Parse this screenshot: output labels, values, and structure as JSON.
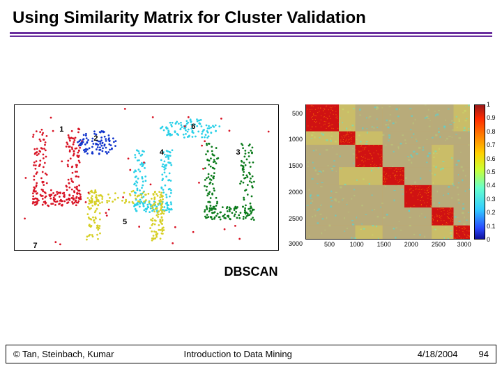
{
  "title": "Using Similarity Matrix for Cluster Validation",
  "caption": "DBSCAN",
  "footer": {
    "authors": "© Tan, Steinbach, Kumar",
    "mid": "Introduction to Data Mining",
    "date": "4/18/2004",
    "page": "94"
  },
  "chart_data": [
    {
      "type": "scatter",
      "title": "",
      "clusters": [
        {
          "id": "1",
          "color": "#d81324",
          "label_pos": [
            0.17,
            0.14
          ],
          "shape": "upper-left-U"
        },
        {
          "id": "2",
          "color": "#1033cc",
          "label_pos": [
            0.3,
            0.2
          ],
          "shape": "blob"
        },
        {
          "id": "3",
          "color": "#0a7a1a",
          "label_pos": [
            0.84,
            0.3
          ],
          "shape": "right-U"
        },
        {
          "id": "4",
          "color": "#2ad0e8",
          "label_pos": [
            0.55,
            0.3
          ],
          "shape": "middle-U"
        },
        {
          "id": "5",
          "color": "#d6cf25",
          "label_pos": [
            0.41,
            0.78
          ],
          "shape": "lower-U"
        },
        {
          "id": "6",
          "color": "#2ad0e8",
          "label_pos": [
            0.67,
            0.12
          ],
          "shape": "upper-blob"
        },
        {
          "id": "7",
          "color": "#d81324",
          "label_pos": [
            0.07,
            0.94
          ],
          "shape": "noise"
        }
      ],
      "xlim": [
        0,
        1
      ],
      "ylim": [
        0,
        1
      ]
    },
    {
      "type": "heatmap",
      "title": "",
      "xlabel": "",
      "ylabel": "",
      "x_ticks": [
        500,
        1000,
        1500,
        2000,
        2500,
        3000
      ],
      "y_ticks": [
        500,
        1000,
        1500,
        2000,
        2500,
        3000
      ],
      "xlim": [
        0,
        3000
      ],
      "ylim": [
        0,
        3000
      ],
      "colorbar": {
        "min": 0,
        "max": 1,
        "ticks": [
          0,
          0.1,
          0.2,
          0.3,
          0.4,
          0.5,
          0.6,
          0.7,
          0.8,
          0.9,
          1
        ]
      },
      "blocks": [
        {
          "start": 0,
          "end": 600,
          "cluster": 1
        },
        {
          "start": 600,
          "end": 900,
          "cluster": 2
        },
        {
          "start": 900,
          "end": 1400,
          "cluster": 3
        },
        {
          "start": 1400,
          "end": 1800,
          "cluster": 4
        },
        {
          "start": 1800,
          "end": 2300,
          "cluster": 5
        },
        {
          "start": 2300,
          "end": 2700,
          "cluster": 6
        },
        {
          "start": 2700,
          "end": 3000,
          "cluster": 7
        }
      ],
      "note": "High similarity (≈1, red) along diagonal blocks; low similarity (≈0.3–0.5, cyan/green) off-diagonal"
    }
  ]
}
